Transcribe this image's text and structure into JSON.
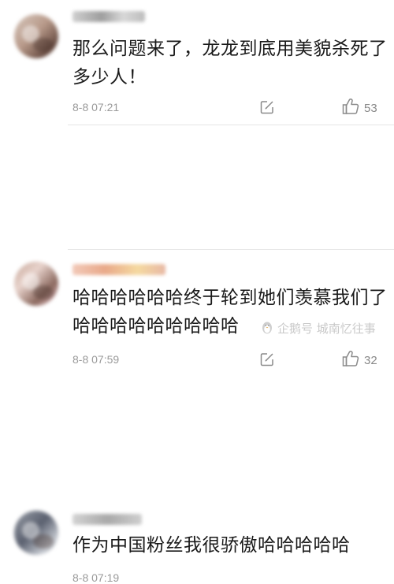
{
  "comments": [
    {
      "text": "那么问题来了，龙龙到底用美貌杀死了多少人！",
      "time": "8-8 07:21",
      "likes": "53",
      "has_actions": true
    },
    {
      "text": "哈哈哈哈哈哈终于轮到她们羡慕我们了哈哈哈哈哈哈哈哈哈",
      "time": "8-8 07:59",
      "likes": "32",
      "has_actions": true
    },
    {
      "text": "作为中国粉丝我很骄傲哈哈哈哈哈",
      "time": "8-8 07:19",
      "likes": "",
      "has_actions": false
    }
  ],
  "watermark": {
    "text": "企鹅号 城南忆往事",
    "icon": "penguin-logo-icon"
  },
  "colors": {
    "text": "#1a1a1a",
    "meta": "#9a9a9a",
    "divider": "#e6e6e6"
  },
  "icons": {
    "reply": "reply-edit-icon",
    "like": "thumbs-up-icon"
  }
}
